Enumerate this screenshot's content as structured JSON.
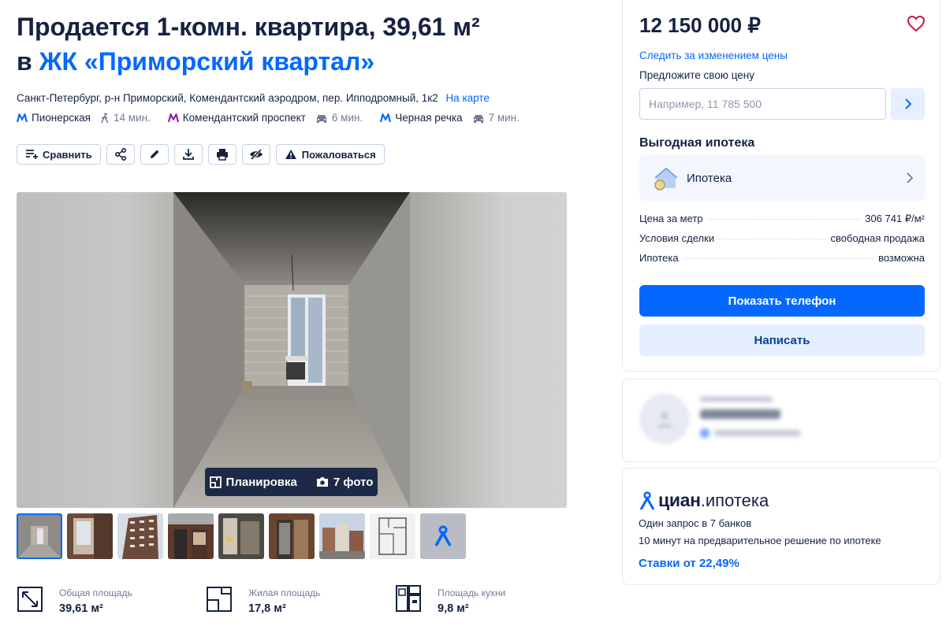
{
  "title": {
    "line1": "Продается 1-комн. квартира, 39,61 м²",
    "prefix": "в",
    "complex": "ЖК «Приморский квартал»"
  },
  "address": {
    "text": "Санкт-Петербург, р-н Приморский, Комендантский аэродром, пер. Ипподромный, 1к2",
    "map_link": "На карте"
  },
  "metro": [
    {
      "station": "Пионерская",
      "color": "#0468ff",
      "transport": "walk",
      "time": "14 мин."
    },
    {
      "station": "Комендантский проспект",
      "color": "#8e1ea7",
      "transport": "car",
      "time": "6 мин."
    },
    {
      "station": "Черная речка",
      "color": "#0468ff",
      "transport": "car",
      "time": "7 мин."
    }
  ],
  "toolbar": {
    "compare": "Сравнить",
    "complain": "Пожаловаться"
  },
  "gallery": {
    "layout_label": "Планировка",
    "photos_label": "7 фото"
  },
  "facts": [
    {
      "label": "Общая площадь",
      "value": "39,61 м²",
      "icon": "total-area-icon"
    },
    {
      "label": "Жилая площадь",
      "value": "17,8 м²",
      "icon": "living-area-icon"
    },
    {
      "label": "Площадь кухни",
      "value": "9,8 м²",
      "icon": "kitchen-area-icon"
    }
  ],
  "offer": {
    "price": "12 150 000 ₽",
    "follow": "Следить за изменением цены",
    "suggest_label": "Предложите свою цену",
    "suggest_placeholder": "Например, 11 785 500",
    "mortgage_heading": "Выгодная ипотека",
    "mortgage_row": "Ипотека",
    "details": [
      {
        "key": "Цена за метр",
        "value": "306 741 ₽/м²"
      },
      {
        "key": "Условия сделки",
        "value": "свободная продажа"
      },
      {
        "key": "Ипотека",
        "value": "возможна"
      }
    ],
    "show_phone": "Показать телефон",
    "write": "Написать"
  },
  "cian_mortgage": {
    "brand_main": "циан",
    "brand_sub": ".ипотека",
    "line1": "Один запрос в 7 банков",
    "line2": "10 минут на предварительное решение по ипотеке",
    "rate": "Ставки от 22,49%"
  },
  "colors": {
    "accent": "#0468ff",
    "text": "#152242",
    "muted": "#707a95"
  }
}
